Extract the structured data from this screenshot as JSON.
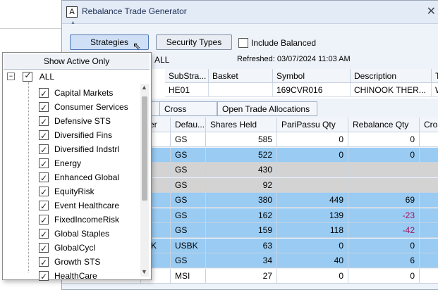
{
  "window": {
    "title": "Rebalance Trade Generator",
    "icon_letter": "A"
  },
  "toolbar": {
    "strategies_label": "Strategies",
    "security_types_label": "Security Types",
    "include_balanced_label": "Include Balanced",
    "all_label": "ALL",
    "refreshed_text": "Refreshed: 03/07/2024 11:03 AM"
  },
  "top_grid": {
    "headers": [
      "SubStra...",
      "Basket",
      "Symbol",
      "Description",
      "Ty"
    ],
    "row": [
      "HE01",
      "",
      "169CVR016",
      "CHINOOK THER...",
      "W"
    ]
  },
  "tabs": [
    "s",
    "Cross Trades",
    "Open Trade Allocations"
  ],
  "bottom_grid": {
    "headers": [
      "ker",
      "Defau...",
      "Shares Held",
      "PariPassu Qty",
      "Rebalance Qty",
      "Cross"
    ],
    "rows": [
      {
        "ticker": "",
        "default": "GS",
        "shares": "585",
        "paripassu": "0",
        "rebalance": "0",
        "style": "white"
      },
      {
        "ticker": "",
        "default": "GS",
        "shares": "522",
        "paripassu": "0",
        "rebalance": "0",
        "style": "blue"
      },
      {
        "ticker": "",
        "default": "GS",
        "shares": "430",
        "paripassu": "",
        "rebalance": "",
        "style": "gray"
      },
      {
        "ticker": "",
        "default": "GS",
        "shares": "92",
        "paripassu": "",
        "rebalance": "",
        "style": "gray"
      },
      {
        "ticker": "",
        "default": "GS",
        "shares": "380",
        "paripassu": "449",
        "rebalance": "69",
        "style": "blue"
      },
      {
        "ticker": "",
        "default": "GS",
        "shares": "162",
        "paripassu": "139",
        "rebalance": "-23",
        "style": "blue"
      },
      {
        "ticker": "",
        "default": "GS",
        "shares": "159",
        "paripassu": "118",
        "rebalance": "-42",
        "style": "blue"
      },
      {
        "ticker": "BK",
        "default": "USBK",
        "shares": "63",
        "paripassu": "0",
        "rebalance": "0",
        "style": "blue"
      },
      {
        "ticker": "",
        "default": "GS",
        "shares": "34",
        "paripassu": "40",
        "rebalance": "6",
        "style": "blue"
      },
      {
        "ticker": "",
        "default": "MSI",
        "shares": "27",
        "paripassu": "0",
        "rebalance": "0",
        "style": "white"
      }
    ]
  },
  "popup": {
    "show_active_label": "Show Active Only",
    "root_label": "ALL",
    "items": [
      "Capital Markets",
      "Consumer Services",
      "Defensive STS",
      "Diversified Fins",
      "Diversified Indstrl",
      "Energy",
      "Enhanced Global",
      "EquityRisk",
      "Event Healthcare",
      "FixedIncomeRisk",
      "Global Staples",
      "GlobalCycl",
      "Growth STS",
      "HealthCare"
    ]
  },
  "colors": {
    "row_blue": "#99cbf3",
    "row_gray": "#d3d3d3",
    "negative": "#a3125d",
    "brand_text": "#1f4fbf"
  }
}
